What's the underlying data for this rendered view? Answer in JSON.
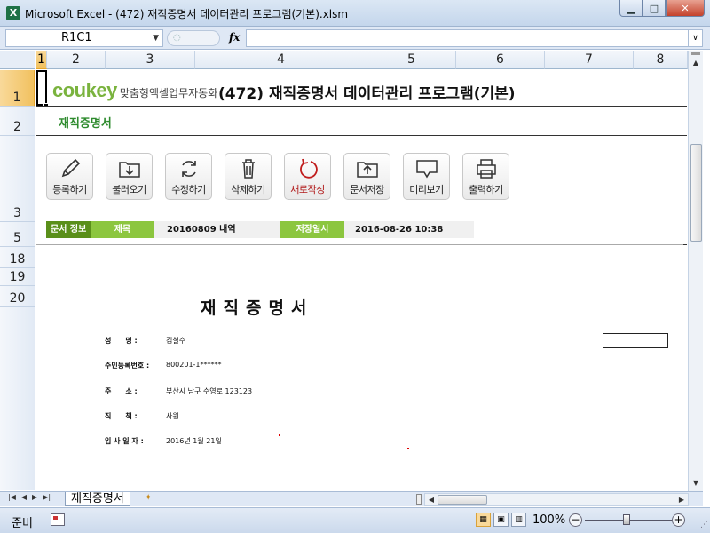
{
  "window": {
    "app_icon": "X",
    "title": "Microsoft Excel - (472) 재직증명서 데이터관리 프로그램(기본).xlsm",
    "controls": [
      "minimize-icon",
      "maximize-icon",
      "close-icon"
    ]
  },
  "formula_bar": {
    "name_box": "R1C1",
    "fx_label": "fx",
    "formula": ""
  },
  "columns": [
    "1",
    "2",
    "3",
    "4",
    "5",
    "6",
    "7",
    "8"
  ],
  "rows": [
    "1",
    "2",
    "3",
    "5",
    "18",
    "19",
    "20"
  ],
  "header": {
    "logo_word": "coukey",
    "logo_sub": "맞춤형엑셀업무자동화",
    "title": "(472) 재직증명서 데이터관리 프로그램(기본)",
    "sheet_label": "재직증명서"
  },
  "toolbar": [
    {
      "label": "등록하기",
      "icon": "pencil-icon"
    },
    {
      "label": "불러오기",
      "icon": "download-folder-icon"
    },
    {
      "label": "수정하기",
      "icon": "refresh-icon"
    },
    {
      "label": "삭제하기",
      "icon": "trash-icon"
    },
    {
      "label": "새로작성",
      "icon": "new-refresh-icon"
    },
    {
      "label": "문서저장",
      "icon": "upload-folder-icon"
    },
    {
      "label": "미리보기",
      "icon": "monitor-icon"
    },
    {
      "label": "출력하기",
      "icon": "printer-icon"
    }
  ],
  "info": {
    "section": "문서 정보",
    "title_label": "제목",
    "title_value": "20160809 내역",
    "saved_label": "저장일시",
    "saved_value": "2016-08-26 10:38"
  },
  "document": {
    "title": "재직증명서",
    "fields": [
      {
        "label": "성　　명 :",
        "value": "김철수"
      },
      {
        "label": "주민등록번호 :",
        "value": "800201-1******"
      },
      {
        "label": "주　　소 :",
        "value": "부산시 남구 수영로 123123"
      },
      {
        "label": "직　　책 :",
        "value": "사원"
      },
      {
        "label": "입 사 일 자 :",
        "value": "2016년 1월 21일"
      }
    ]
  },
  "tabs": {
    "sheet": "재직증명서"
  },
  "status": {
    "ready": "준비",
    "zoom": "100%"
  },
  "colors": {
    "accent_green": "#8cc63f",
    "dark_green": "#5a8f1a",
    "label_green": "#2e8b2e",
    "selection": "#f1c15f"
  }
}
